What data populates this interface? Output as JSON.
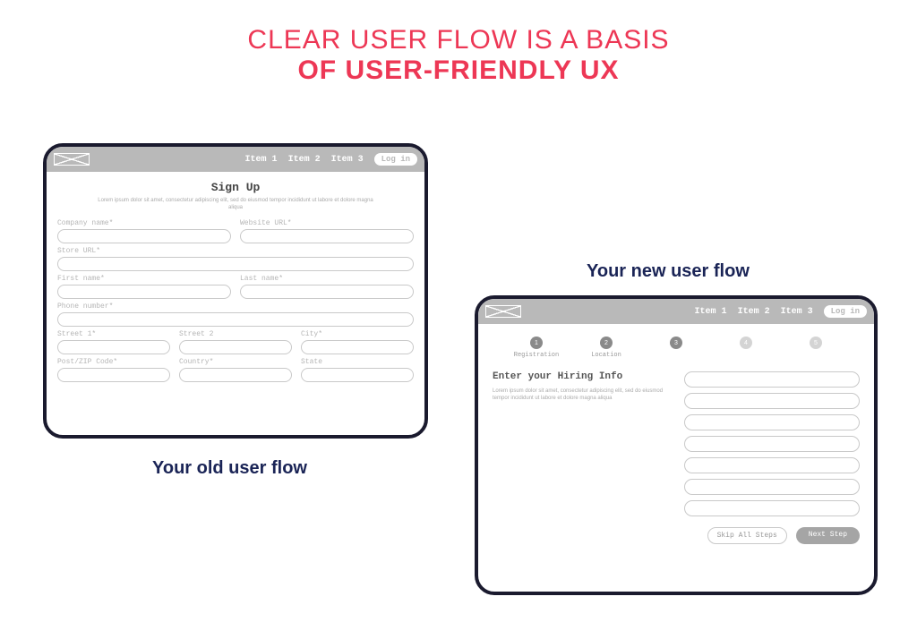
{
  "title": {
    "line1": "CLEAR USER FLOW IS A BASIS",
    "line2": "OF USER-FRIENDLY UX"
  },
  "captions": {
    "old": "Your old user flow",
    "new": "Your new user flow"
  },
  "nav": {
    "item1": "Item 1",
    "item2": "Item 2",
    "item3": "Item 3",
    "login": "Log in"
  },
  "old_form": {
    "heading": "Sign Up",
    "lorem": "Lorem ipsum dolor sit amet, consectetur adipiscing elit, sed do eiusmod tempor incididunt ut labore et dolore magna aliqua",
    "labels": {
      "company": "Company name*",
      "website": "Website URL*",
      "store": "Store URL*",
      "first": "First name*",
      "last": "Last name*",
      "phone": "Phone number*",
      "street1": "Street 1*",
      "street2": "Street 2",
      "city": "City*",
      "zip": "Post/ZIP Code*",
      "country": "Country*",
      "state": "State"
    }
  },
  "new_flow": {
    "steps": {
      "s1": {
        "num": "1",
        "label": "Registration"
      },
      "s2": {
        "num": "2",
        "label": "Location"
      },
      "s3": {
        "num": "3",
        "label": ""
      },
      "s4": {
        "num": "4",
        "label": ""
      },
      "s5": {
        "num": "5",
        "label": ""
      }
    },
    "heading": "Enter your Hiring Info",
    "lorem": "Lorem ipsum dolor sit amet, consectetur adipiscing elit, sed do eiusmod tempor incididunt ut labore et dolore magna aliqua",
    "buttons": {
      "skip": "Skip All Steps",
      "next": "Next Step"
    }
  }
}
